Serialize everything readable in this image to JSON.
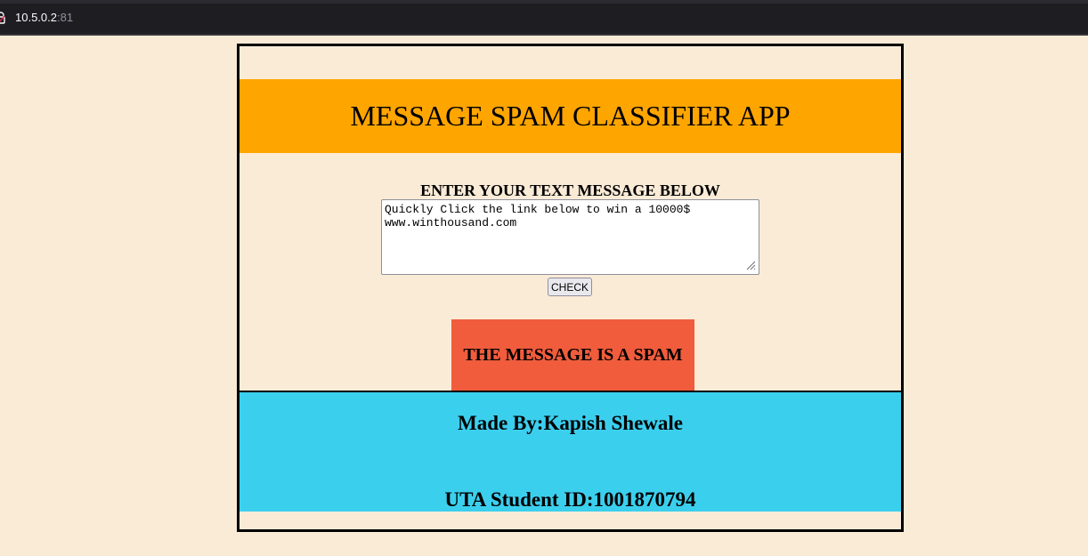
{
  "browser": {
    "url_host": "10.5.0.2",
    "url_port": ":81"
  },
  "app": {
    "title": "MESSAGE SPAM CLASSIFIER APP",
    "prompt": "ENTER YOUR TEXT MESSAGE BELOW",
    "message_value": "Quickly Click the link below to win a 10000$ www.winthousand.com",
    "check_label": "CHECK",
    "result": "THE MESSAGE IS A SPAM"
  },
  "footer": {
    "credit": "Made By:Kapish Shewale",
    "student_id": "UTA Student ID:1001870794"
  },
  "colors": {
    "header_bg": "#ffa500",
    "page_bg": "#faebd7",
    "result_bg": "#f05c3c",
    "footer_bg": "#3bcfee"
  }
}
